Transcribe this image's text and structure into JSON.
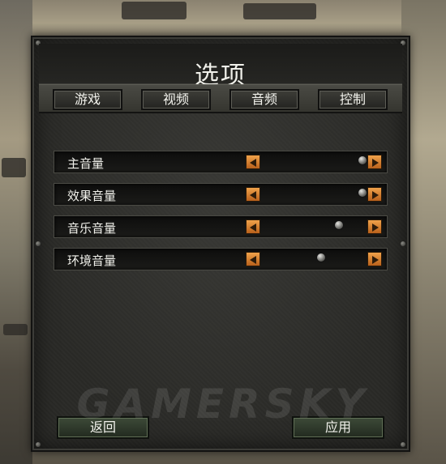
{
  "dialog": {
    "title": "选项"
  },
  "tabs": [
    {
      "label": "游戏"
    },
    {
      "label": "视频"
    },
    {
      "label": "音频"
    },
    {
      "label": "控制"
    }
  ],
  "sliders": [
    {
      "label": "主音量",
      "value": 1.0
    },
    {
      "label": "效果音量",
      "value": 1.0
    },
    {
      "label": "音乐音量",
      "value": 0.75
    },
    {
      "label": "环境音量",
      "value": 0.56
    }
  ],
  "buttons": {
    "back_label": "返回",
    "apply_label": "应用"
  },
  "watermark": "GAMERSKY",
  "colors": {
    "arrow_orange": "#e08a34",
    "panel_dark": "#2a2a27",
    "button_green": "#3d4a38"
  }
}
